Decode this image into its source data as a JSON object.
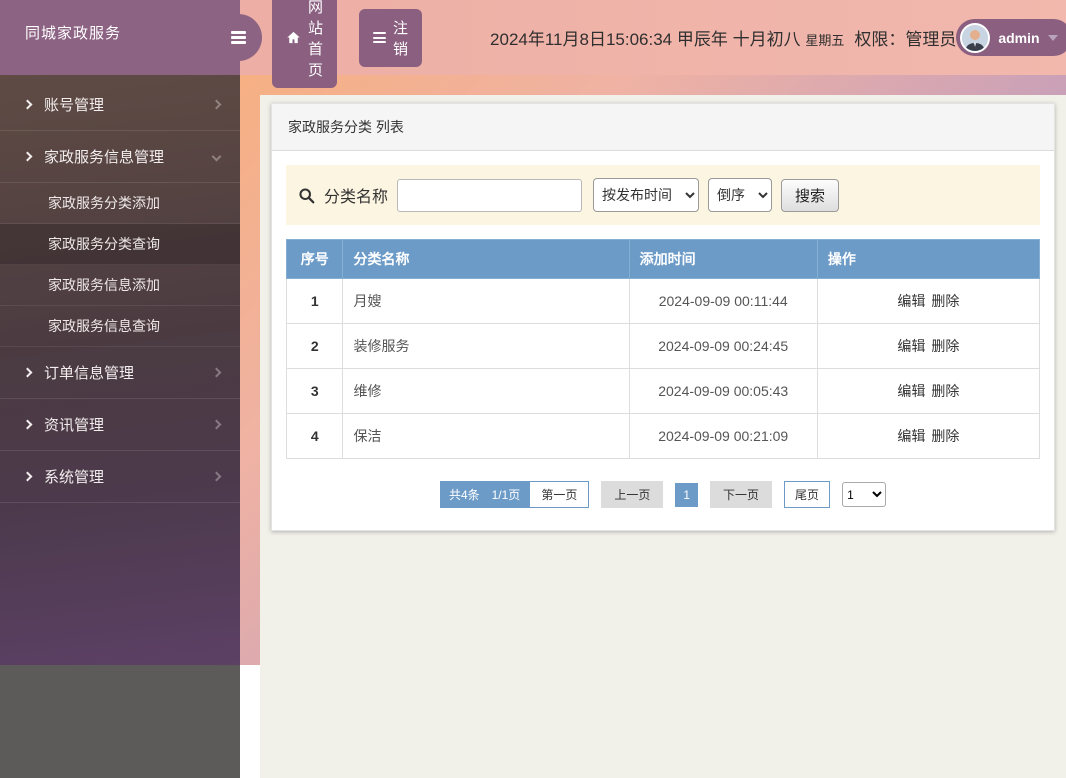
{
  "app": {
    "title": "同城家政服务"
  },
  "header": {
    "home_button": "网站首页",
    "logout_button": "注销",
    "datetime": "2024年11月8日15:06:34 甲辰年 十月初八",
    "weekday": "星期五",
    "role_label": "权限：管理员",
    "username": "admin"
  },
  "sidebar": {
    "items": [
      {
        "label": "账号管理",
        "expanded": false
      },
      {
        "label": "家政服务信息管理",
        "expanded": true,
        "children": [
          {
            "label": "家政服务分类添加",
            "active": false
          },
          {
            "label": "家政服务分类查询",
            "active": true
          },
          {
            "label": "家政服务信息添加",
            "active": false
          },
          {
            "label": "家政服务信息查询",
            "active": false
          }
        ]
      },
      {
        "label": "订单信息管理",
        "expanded": false
      },
      {
        "label": "资讯管理",
        "expanded": false
      },
      {
        "label": "系统管理",
        "expanded": false
      }
    ]
  },
  "panel": {
    "title": "家政服务分类 列表",
    "search": {
      "label": "分类名称",
      "input_value": "",
      "sort_field": "按发布时间",
      "sort_order": "倒序",
      "button": "搜索"
    },
    "table": {
      "columns": [
        "序号",
        "分类名称",
        "添加时间",
        "操作"
      ],
      "rows": [
        {
          "no": "1",
          "name": "月嫂",
          "time": "2024-09-09 00:11:44"
        },
        {
          "no": "2",
          "name": "装修服务",
          "time": "2024-09-09 00:24:45"
        },
        {
          "no": "3",
          "name": "维修",
          "time": "2024-09-09 00:05:43"
        },
        {
          "no": "4",
          "name": "保洁",
          "time": "2024-09-09 00:21:09"
        }
      ],
      "actions": [
        "编辑",
        "删除"
      ]
    },
    "pagination": {
      "total": "共4条",
      "page_info": "1/1页",
      "first": "第一页",
      "prev": "上一页",
      "current": "1",
      "next": "下一页",
      "last": "尾页",
      "page_select": "1"
    }
  },
  "colors": {
    "brand_purple": "#8d6384",
    "button_purple": "#8a5f80",
    "header_pink": "#f0b3a9",
    "table_header_blue": "#6c9bc8",
    "pagination_gray": "#dcdcdc",
    "search_bar_cream": "#fcf5e2",
    "content_beige": "#f1f0e9",
    "sidebar_footer_gray": "#5d5a5a"
  }
}
